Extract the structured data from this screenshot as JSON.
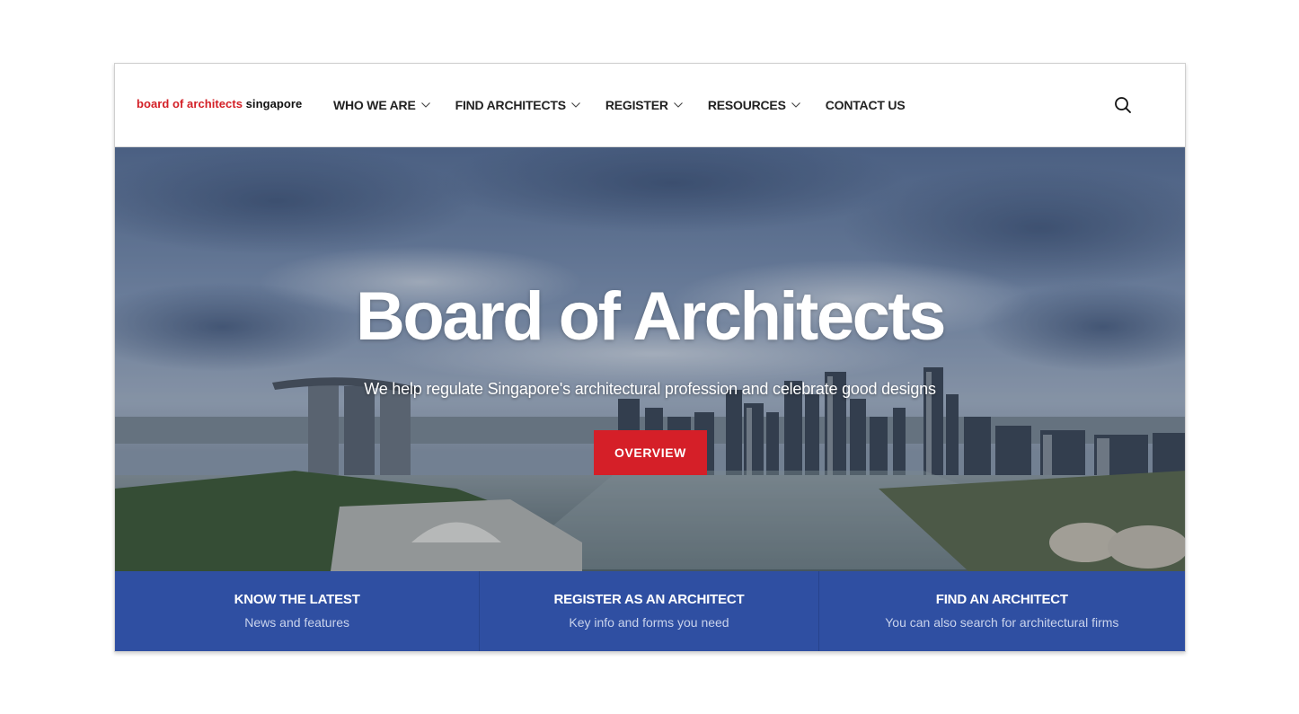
{
  "header": {
    "logo_part1": "board of architects",
    "logo_part2": "singapore",
    "nav": [
      {
        "label": "WHO WE ARE",
        "has_dropdown": true
      },
      {
        "label": "FIND ARCHITECTS",
        "has_dropdown": true
      },
      {
        "label": "REGISTER",
        "has_dropdown": true
      },
      {
        "label": "RESOURCES",
        "has_dropdown": true
      },
      {
        "label": "CONTACT US",
        "has_dropdown": false
      }
    ],
    "search_icon": "search-icon"
  },
  "hero": {
    "title": "Board of Architects",
    "subtitle": "We help regulate Singapore's architectural profession and celebrate good designs",
    "button_label": "OVERVIEW"
  },
  "panels": [
    {
      "title": "KNOW THE LATEST",
      "subtitle": "News and features"
    },
    {
      "title": "REGISTER AS AN ARCHITECT",
      "subtitle": "Key info and forms you need"
    },
    {
      "title": "FIND AN ARCHITECT",
      "subtitle": "You can also search for architectural firms"
    }
  ],
  "colors": {
    "brand_red": "#d31f26",
    "button_red": "#d51f28",
    "panel_blue": "#2f4fa2",
    "text_dark": "#222222"
  }
}
